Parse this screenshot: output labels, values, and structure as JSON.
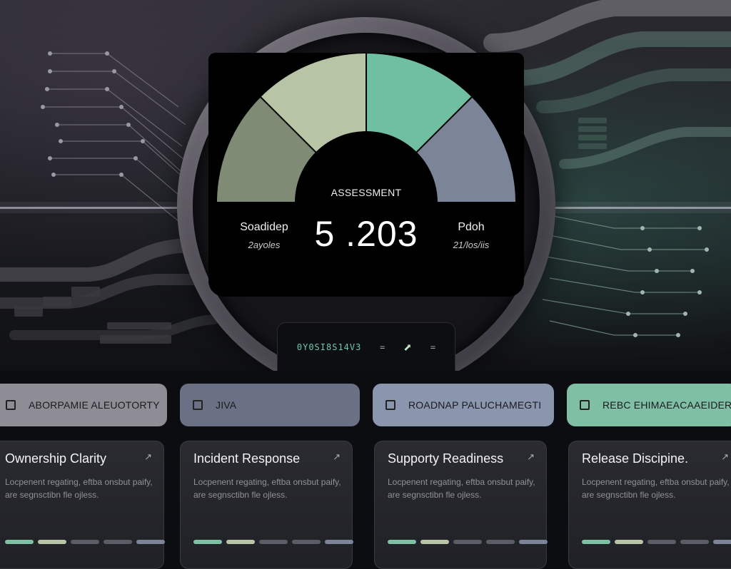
{
  "gauge": {
    "title": "ASSESSMENT",
    "value": "5 .203",
    "left_label": "Soadidep",
    "left_sub": "2ayoles",
    "right_label": "Pdoh",
    "right_sub": "21/los/iis"
  },
  "readout": {
    "code": "0Y0SI8S14V3",
    "sep1": "=",
    "sep2": "=",
    "arrow_icon": "arrow-up-right-icon"
  },
  "pills": [
    {
      "label": "ABORPAMIE ALEUOTORTY",
      "color": "#8e8d95",
      "icon": "list-icon"
    },
    {
      "label": "JIVA",
      "color": "#6b7184",
      "icon": "flag-icon"
    },
    {
      "label": "ROADNAP PALUCHAMEGTI",
      "color": "#8a96ad",
      "icon": "list-icon"
    },
    {
      "label": "REBC EHIMAEACAAEIDERT",
      "color": "#7fc0a5",
      "icon": "list-icon"
    }
  ],
  "cards": [
    {
      "title": "Ownership Clarity",
      "desc": "Locpenent regating, eftba onsbut paify, are segnsctibn fle ojless.",
      "icon": "arrow-up-right-icon"
    },
    {
      "title": "Incident Response",
      "desc": "Locpenent regating, eftba onsbut paify, are segnsctibn fle ojless.",
      "icon": "arrow-up-right-icon"
    },
    {
      "title": "Supporty Readiness",
      "desc": "Locpenent regating, eftba onsbut paify, are segnsctibn fle ojless.",
      "icon": "arrow-up-right-icon"
    },
    {
      "title": "Release Discipine.",
      "desc": "Locpenent regating, eftba onsbut paify, are segnsctibn fle ojless.",
      "icon": "arrow-up-right-icon"
    }
  ],
  "colors": {
    "segment_1": "#7f8b74",
    "segment_2": "#b8c4a6",
    "segment_3": "#6fbfa0",
    "segment_4": "#7b8597",
    "bar_palette": [
      "#7fc0a5",
      "#b8c4a6",
      "#5a5d66",
      "#5a5d66",
      "#7b8597"
    ]
  }
}
